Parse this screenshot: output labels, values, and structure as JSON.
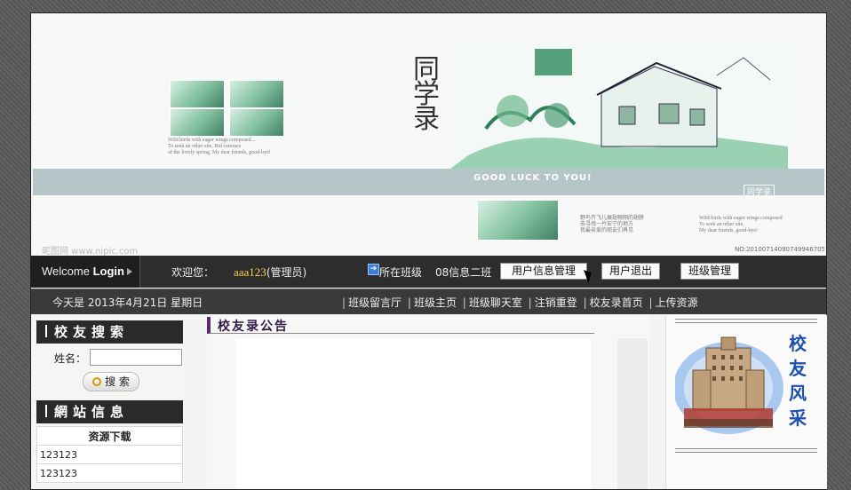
{
  "banner": {
    "title": "同学录",
    "band_text": "GOOD LUCK TO YOU!",
    "stamp": "同学录",
    "watermark": "昵图网 www.nipic.com",
    "serial": "NO:20100714090749946705"
  },
  "nav": {
    "welcome_label": "Welcome",
    "login_label": "Login",
    "greeting": "欢迎您：",
    "username": "aaa123",
    "role": "(管理员)",
    "class_label": "所在班级",
    "class_name": "08信息二班",
    "buttons": [
      "用户信息管理",
      "用户退出",
      "班级管理"
    ]
  },
  "subnav": {
    "date": "今天是 2013年4月21日 星期日",
    "links": [
      "班级留言厅",
      "班级主页",
      "班级聊天室",
      "注销重登",
      "校友录首页",
      "上传资源"
    ]
  },
  "sidebar": {
    "search_title": "校友搜索",
    "name_label": "姓名：",
    "name_value": "",
    "search_button": "搜 索",
    "site_title": "網站信息",
    "resources_header": "资源下载",
    "resources": [
      "123123",
      "123123"
    ]
  },
  "main": {
    "notice_title": "校友录公告"
  },
  "right": {
    "caption": "校友风采"
  },
  "colors": {
    "accent_purple": "#5b2a6b",
    "username": "#ffd54a",
    "nav_bg": "#2d2d2d"
  }
}
